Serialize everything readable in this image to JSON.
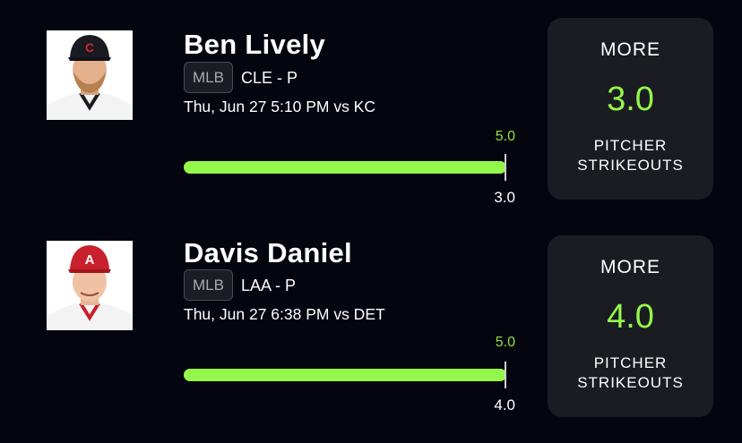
{
  "picks": [
    {
      "player_name": "Ben Lively",
      "league": "MLB",
      "team_position": "CLE - P",
      "game_time": "Thu, Jun 27 5:10 PM  vs KC",
      "bar": {
        "max_label": "5.0",
        "value_label": "3.0",
        "max": 5.0,
        "value": 3.0,
        "fill_fraction": 1.0
      },
      "card": {
        "direction": "MORE",
        "line": "3.0",
        "stat_line1": "PITCHER",
        "stat_line2": "STRIKEOUTS"
      },
      "cap_color": "#1a1a22",
      "cap_logo": "C",
      "cap_logo_color": "#d4262e",
      "jersey_icon": "cleveland-player-photo"
    },
    {
      "player_name": "Davis Daniel",
      "league": "MLB",
      "team_position": "LAA - P",
      "game_time": "Thu, Jun 27 6:38 PM  vs DET",
      "bar": {
        "max_label": "5.0",
        "value_label": "4.0",
        "max": 5.0,
        "value": 4.0,
        "fill_fraction": 1.0
      },
      "card": {
        "direction": "MORE",
        "line": "4.0",
        "stat_line1": "PITCHER",
        "stat_line2": "STRIKEOUTS"
      },
      "cap_color": "#c8202c",
      "cap_logo": "A",
      "cap_logo_color": "#ffffff",
      "jersey_icon": "angels-player-photo"
    }
  ],
  "colors": {
    "background": "#05050f",
    "accent_green": "#93f84a",
    "card_bg": "#1b1b22"
  }
}
